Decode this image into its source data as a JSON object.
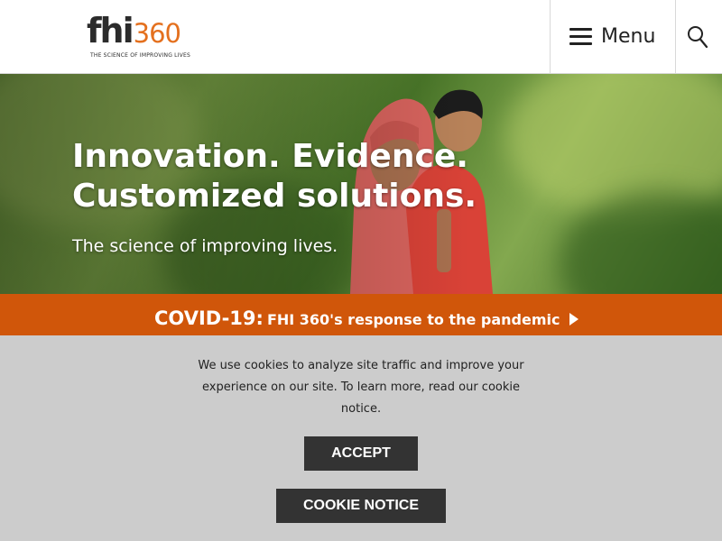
{
  "header": {
    "logo": {
      "mark_letters": "fhi",
      "mark_digits": "360",
      "tagline": "THE SCIENCE OF IMPROVING LIVES",
      "accent_color": "#e4701e"
    },
    "menu_label": "Menu",
    "menu_icon": "hamburger-icon",
    "search_icon": "search-icon"
  },
  "hero": {
    "title_line1": "Innovation. Evidence.",
    "title_line2": "Customized solutions.",
    "subtitle": "The science of improving lives."
  },
  "covid_banner": {
    "strong": "COVID-19:",
    "text": "FHI 360's response to the pandemic",
    "arrow_icon": "play-arrow-icon",
    "background_color": "#d0560a"
  },
  "cookie_banner": {
    "message": "We use cookies to analyze site traffic and improve your experience on our site. To learn more, read our cookie notice.",
    "accept_label": "ACCEPT",
    "notice_label": "COOKIE NOTICE",
    "background_color": "#cccccc",
    "button_color": "#333333"
  }
}
